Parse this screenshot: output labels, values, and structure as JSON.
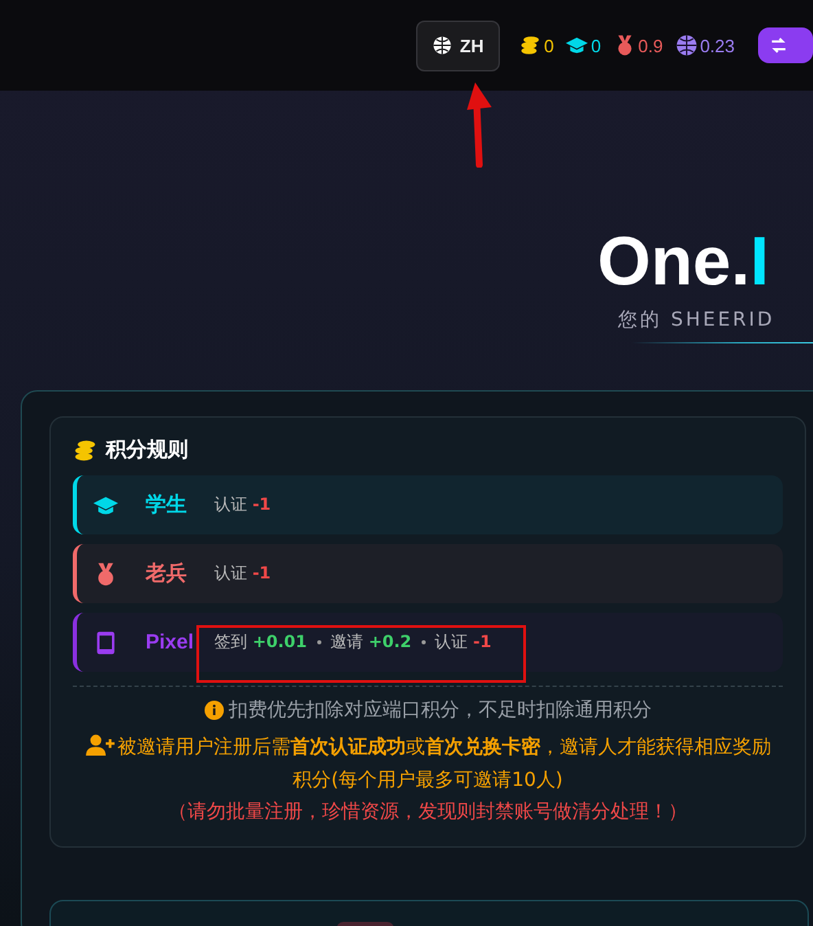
{
  "top_bar": {
    "language_button": {
      "label": "ZH"
    },
    "balances": [
      {
        "kind": "coins",
        "value": "0",
        "color": "#f5c400"
      },
      {
        "kind": "student",
        "value": "0",
        "color": "#00d8e8"
      },
      {
        "kind": "veteran",
        "value": "0.9",
        "color": "#e85a5a"
      },
      {
        "kind": "global",
        "value": "0.23",
        "color": "#9a7cf0"
      }
    ]
  },
  "hero": {
    "title": "One.",
    "title_accent": "I",
    "subtitle": "您的 SHEERID"
  },
  "rules_card": {
    "title": "积分规则",
    "rules": [
      {
        "kind": "student",
        "name": "学生",
        "items": [
          {
            "label": "认证",
            "value": "-1",
            "kind": "cost"
          }
        ]
      },
      {
        "kind": "veteran",
        "name": "老兵",
        "items": [
          {
            "label": "认证",
            "value": "-1",
            "kind": "cost"
          }
        ]
      },
      {
        "kind": "pixel",
        "name": "Pixel",
        "items": [
          {
            "label": "签到",
            "value": "+0.01",
            "kind": "gain"
          },
          {
            "label": "邀请",
            "value": "+0.2",
            "kind": "gain"
          },
          {
            "label": "认证",
            "value": "-1",
            "kind": "cost"
          }
        ]
      }
    ],
    "note": "扣费优先扣除对应端口积分，不足时扣除通用积分",
    "invite_note": "被邀请用户注册后需**首次认证成功**或**首次兑换卡密**，邀请人才能获得相应奖励积分(每个用户最多可邀请10人)",
    "warning": "（请勿批量注册，珍惜资源，发现则封禁账号做清分处理！）"
  }
}
